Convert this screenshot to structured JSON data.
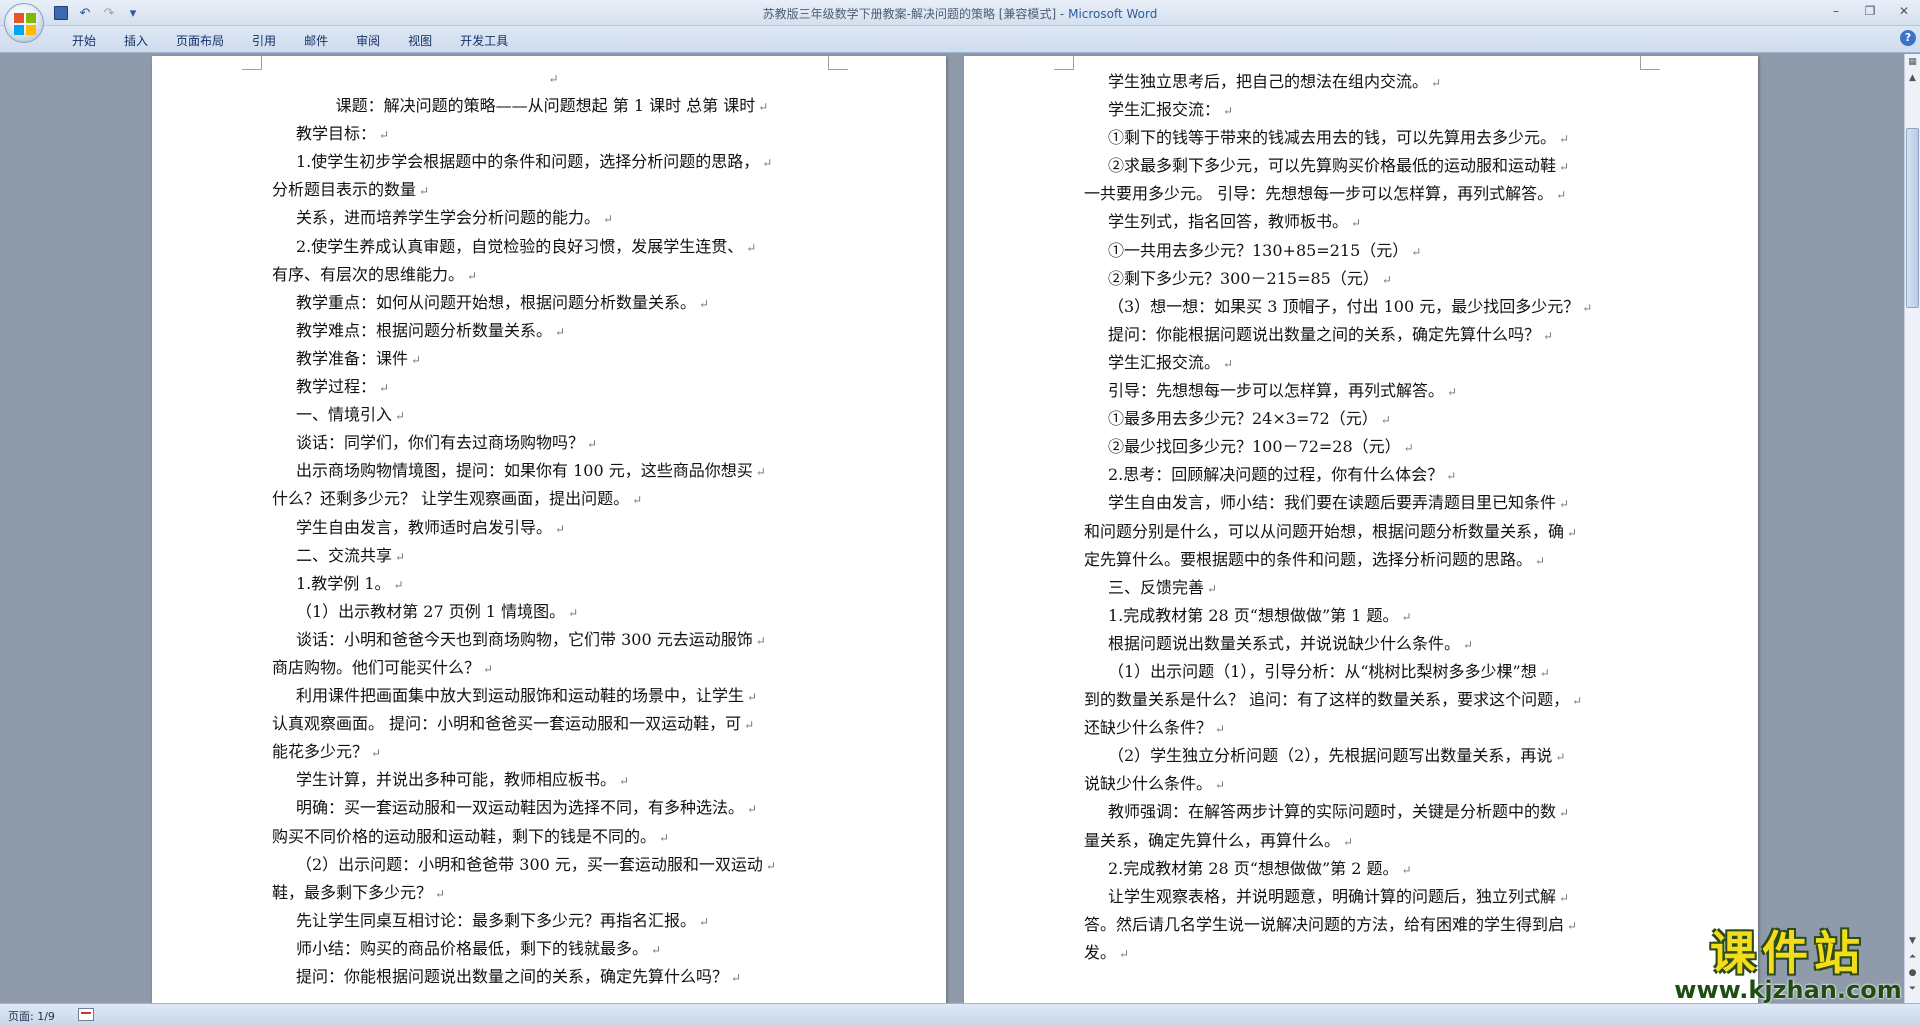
{
  "window": {
    "title": "苏教版三年级数学下册教案-解决问题的策略 [兼容模式] - ",
    "app_name": "Microsoft Word"
  },
  "quick_access": {
    "items": [
      "save-icon",
      "undo-icon",
      "redo-icon",
      "customize-icon"
    ],
    "customize_glyph": "▾"
  },
  "ribbon": {
    "tabs": [
      "开始",
      "插入",
      "页面布局",
      "引用",
      "邮件",
      "审阅",
      "视图",
      "开发工具"
    ],
    "help_glyph": "?"
  },
  "window_controls": [
    "–",
    "❐",
    "✕"
  ],
  "document": {
    "pilcrow": "↵",
    "left_page": [
      {
        "text": "",
        "style": "center"
      },
      {
        "text": "课题：解决问题的策略——从问题想起  第  1  课时  总第  课时",
        "style": "center"
      },
      {
        "text": "教学目标：",
        "style": "ind"
      },
      {
        "text": "1.使学生初步学会根据题中的条件和问题，选择分析问题的思路，",
        "style": "ind"
      },
      {
        "text": "分析题目表示的数量",
        "style": ""
      },
      {
        "text": "关系，进而培养学生学会分析问题的能力。",
        "style": "ind"
      },
      {
        "text": "2.使学生养成认真审题，自觉检验的良好习惯，发展学生连贯、",
        "style": "ind"
      },
      {
        "text": "有序、有层次的思维能力。",
        "style": ""
      },
      {
        "text": "教学重点：如何从问题开始想，根据问题分析数量关系。",
        "style": "ind"
      },
      {
        "text": "教学难点：根据问题分析数量关系。",
        "style": "ind"
      },
      {
        "text": "教学准备：课件",
        "style": "ind"
      },
      {
        "text": "教学过程：",
        "style": "ind"
      },
      {
        "text": "一、情境引入",
        "style": "ind"
      },
      {
        "text": "谈话：同学们，你们有去过商场购物吗？",
        "style": "ind"
      },
      {
        "text": "出示商场购物情境图，提问：如果你有 100 元，这些商品你想买",
        "style": "ind"
      },
      {
        "text": "什么？还剩多少元？ 让学生观察画面，提出问题。",
        "style": ""
      },
      {
        "text": "学生自由发言，教师适时启发引导。",
        "style": "ind"
      },
      {
        "text": "二、交流共享",
        "style": "ind"
      },
      {
        "text": "1.教学例 1。",
        "style": "ind"
      },
      {
        "text": "（1）出示教材第 27 页例 1 情境图。",
        "style": "ind"
      },
      {
        "text": "谈话：小明和爸爸今天也到商场购物，它们带 300 元去运动服饰",
        "style": "ind"
      },
      {
        "text": "商店购物。他们可能买什么？",
        "style": ""
      },
      {
        "text": "利用课件把画面集中放大到运动服饰和运动鞋的场景中，让学生",
        "style": "ind"
      },
      {
        "text": "认真观察画面。 提问：小明和爸爸买一套运动服和一双运动鞋，可",
        "style": ""
      },
      {
        "text": "能花多少元？",
        "style": ""
      },
      {
        "text": "学生计算，并说出多种可能，教师相应板书。",
        "style": "ind"
      },
      {
        "text": "明确：买一套运动服和一双运动鞋因为选择不同，有多种选法。",
        "style": "ind"
      },
      {
        "text": "购买不同价格的运动服和运动鞋，剩下的钱是不同的。",
        "style": ""
      },
      {
        "text": "（2）出示问题：小明和爸爸带 300 元，买一套运动服和一双运动",
        "style": "ind"
      },
      {
        "text": "鞋，最多剩下多少元？",
        "style": ""
      },
      {
        "text": "先让学生同桌互相讨论：最多剩下多少元？再指名汇报。",
        "style": "ind"
      },
      {
        "text": "师小结：购买的商品价格最低，剩下的钱就最多。",
        "style": "ind"
      },
      {
        "text": "提问：你能根据问题说出数量之间的关系，确定先算什么吗？",
        "style": "ind"
      }
    ],
    "right_page": [
      {
        "text": "学生独立思考后，把自己的想法在组内交流。",
        "style": "ind"
      },
      {
        "text": "学生汇报交流：",
        "style": "ind"
      },
      {
        "text": "①剩下的钱等于带来的钱减去用去的钱，可以先算用去多少元。",
        "style": "ind"
      },
      {
        "text": "②求最多剩下多少元，可以先算购买价格最低的运动服和运动鞋",
        "style": "ind"
      },
      {
        "text": "一共要用多少元。 引导：先想想每一步可以怎样算，再列式解答。",
        "style": ""
      },
      {
        "text": "学生列式，指名回答，教师板书。",
        "style": "ind"
      },
      {
        "text": "①一共用去多少元？130+85=215（元）",
        "style": "ind"
      },
      {
        "text": "②剩下多少元？300－215=85（元）",
        "style": "ind"
      },
      {
        "text": "（3）想一想：如果买 3 顶帽子，付出 100 元，最少找回多少元？",
        "style": "ind"
      },
      {
        "text": "提问：你能根据问题说出数量之间的关系，确定先算什么吗？",
        "style": "ind"
      },
      {
        "text": "学生汇报交流。",
        "style": "ind"
      },
      {
        "text": "引导：先想想每一步可以怎样算，再列式解答。",
        "style": "ind"
      },
      {
        "text": "①最多用去多少元？24×3=72（元）",
        "style": "ind"
      },
      {
        "text": "②最少找回多少元？100－72=28（元）",
        "style": "ind"
      },
      {
        "text": "2.思考：回顾解决问题的过程，你有什么体会？",
        "style": "ind"
      },
      {
        "text": "学生自由发言，师小结：我们要在读题后要弄清题目里已知条件",
        "style": "ind"
      },
      {
        "text": "和问题分别是什么，可以从问题开始想，根据问题分析数量关系，确",
        "style": ""
      },
      {
        "text": "定先算什么。要根据题中的条件和问题，选择分析问题的思路。",
        "style": ""
      },
      {
        "text": "三、反馈完善",
        "style": "ind"
      },
      {
        "text": "1.完成教材第 28 页“想想做做”第 1 题。",
        "style": "ind"
      },
      {
        "text": "根据问题说出数量关系式，并说说缺少什么条件。",
        "style": "ind"
      },
      {
        "text": "（1）出示问题（1），引导分析：从“桃树比梨树多多少棵”想",
        "style": "ind"
      },
      {
        "text": "到的数量关系是什么？ 追问：有了这样的数量关系，要求这个问题，",
        "style": ""
      },
      {
        "text": "还缺少什么条件？",
        "style": ""
      },
      {
        "text": "（2）学生独立分析问题（2），先根据问题写出数量关系，再说",
        "style": "ind"
      },
      {
        "text": "说缺少什么条件。",
        "style": ""
      },
      {
        "text": "教师强调：在解答两步计算的实际问题时，关键是分析题中的数",
        "style": "ind"
      },
      {
        "text": "量关系，确定先算什么，再算什么。",
        "style": ""
      },
      {
        "text": "2.完成教材第 28 页“想想做做”第 2 题。",
        "style": "ind"
      },
      {
        "text": "让学生观察表格，并说明题意，明确计算的问题后，独立列式解",
        "style": "ind"
      },
      {
        "text": "答。然后请几名学生说一说解决问题的方法，给有困难的学生得到启",
        "style": ""
      },
      {
        "text": "发。",
        "style": ""
      }
    ]
  },
  "status": {
    "page": "页面: 1/9"
  },
  "watermark": {
    "text": "课件站",
    "url": "www.kjzhan.com"
  }
}
